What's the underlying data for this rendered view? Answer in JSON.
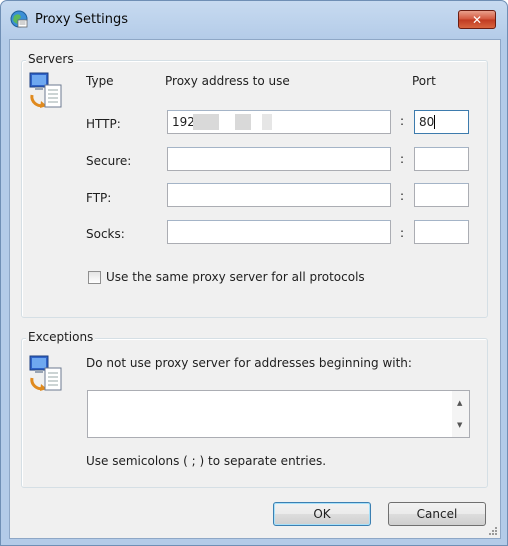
{
  "window": {
    "title": "Proxy Settings",
    "close_glyph": "✕",
    "title_icon": "globe-icon"
  },
  "servers": {
    "group_title": "Servers",
    "icon": "computer-page-icon",
    "header_type": "Type",
    "header_address": "Proxy address to use",
    "header_port": "Port",
    "separator": ":",
    "rows": [
      {
        "type": "HTTP:",
        "address": "192",
        "port": "80"
      },
      {
        "type": "Secure:",
        "address": "",
        "port": ""
      },
      {
        "type": "FTP:",
        "address": "",
        "port": ""
      },
      {
        "type": "Socks:",
        "address": "",
        "port": ""
      }
    ],
    "same_proxy_label": "Use the same proxy server for all protocols",
    "same_proxy_checked": false
  },
  "exceptions": {
    "group_title": "Exceptions",
    "icon": "computer-page-icon",
    "description": "Do not use proxy server for addresses beginning with:",
    "value": "",
    "hint": "Use semicolons ( ; ) to separate entries."
  },
  "buttons": {
    "ok": "OK",
    "cancel": "Cancel"
  },
  "colors": {
    "title_bar": "#b3cbe8",
    "close_button": "#c03a21",
    "dialog_bg": "#f0f0f0",
    "focus_border": "#3d7bad"
  }
}
